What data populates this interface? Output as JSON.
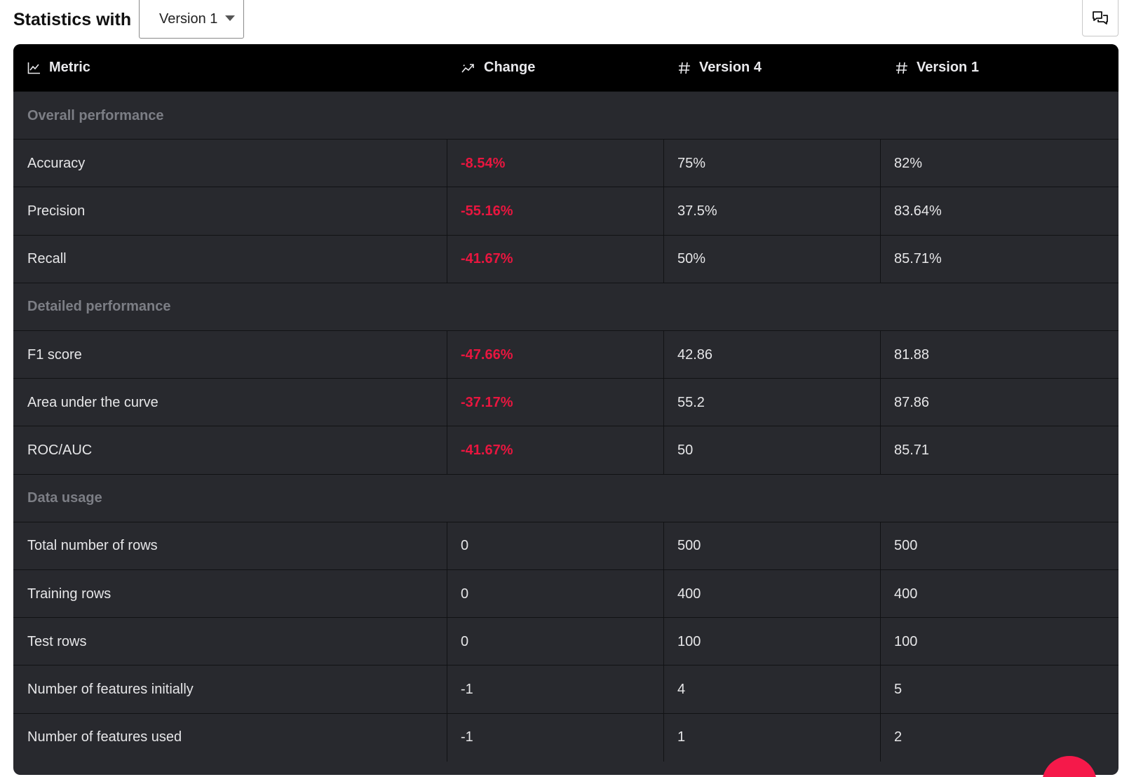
{
  "header": {
    "title": "Statistics with",
    "version_select": {
      "value": "Version 1"
    }
  },
  "table": {
    "columns": [
      {
        "label": "Metric",
        "icon": "line-chart-icon"
      },
      {
        "label": "Change",
        "icon": "trend-icon"
      },
      {
        "label": "Version 4",
        "icon": "hash-icon"
      },
      {
        "label": "Version 1",
        "icon": "hash-icon"
      }
    ],
    "sections": [
      {
        "label": "Overall performance",
        "rows": [
          {
            "metric": "Accuracy",
            "change": "-8.54%",
            "v4": "75%",
            "v1": "82%",
            "negative": true
          },
          {
            "metric": "Precision",
            "change": "-55.16%",
            "v4": "37.5%",
            "v1": "83.64%",
            "negative": true
          },
          {
            "metric": "Recall",
            "change": "-41.67%",
            "v4": "50%",
            "v1": "85.71%",
            "negative": true
          }
        ]
      },
      {
        "label": "Detailed performance",
        "rows": [
          {
            "metric": "F1 score",
            "change": "-47.66%",
            "v4": "42.86",
            "v1": "81.88",
            "negative": true
          },
          {
            "metric": "Area under the curve",
            "change": "-37.17%",
            "v4": "55.2",
            "v1": "87.86",
            "negative": true
          },
          {
            "metric": "ROC/AUC",
            "change": "-41.67%",
            "v4": "50",
            "v1": "85.71",
            "negative": true
          }
        ]
      },
      {
        "label": "Data usage",
        "rows": [
          {
            "metric": "Total number of rows",
            "change": "0",
            "v4": "500",
            "v1": "500",
            "negative": false
          },
          {
            "metric": "Training rows",
            "change": "0",
            "v4": "400",
            "v1": "400",
            "negative": false
          },
          {
            "metric": "Test rows",
            "change": "0",
            "v4": "100",
            "v1": "100",
            "negative": false
          },
          {
            "metric": "Number of features initially",
            "change": "-1",
            "v4": "4",
            "v1": "5",
            "negative": false
          },
          {
            "metric": "Number of features used",
            "change": "-1",
            "v4": "1",
            "v1": "2",
            "negative": false
          }
        ]
      }
    ]
  },
  "colors": {
    "negative": "#e8163f",
    "header_bg": "#000000",
    "table_bg": "#28292e",
    "fab": "#f5194a"
  }
}
